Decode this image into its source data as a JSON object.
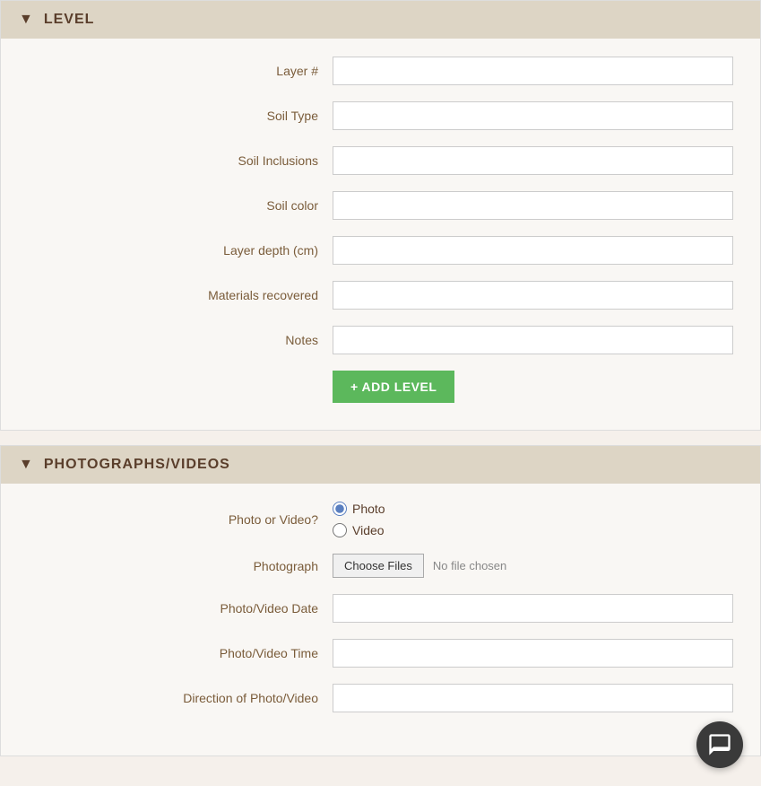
{
  "level_section": {
    "title": "LEVEL",
    "chevron": "▼",
    "fields": [
      {
        "label": "Layer #",
        "name": "layer-number",
        "value": ""
      },
      {
        "label": "Soil Type",
        "name": "soil-type",
        "value": ""
      },
      {
        "label": "Soil Inclusions",
        "name": "soil-inclusions",
        "value": ""
      },
      {
        "label": "Soil color",
        "name": "soil-color",
        "value": ""
      },
      {
        "label": "Layer depth (cm)",
        "name": "layer-depth",
        "value": ""
      },
      {
        "label": "Materials recovered",
        "name": "materials-recovered",
        "value": ""
      },
      {
        "label": "Notes",
        "name": "notes",
        "value": ""
      }
    ],
    "add_button": "+ ADD LEVEL"
  },
  "photos_section": {
    "title": "PHOTOGRAPHS/VIDEOS",
    "chevron": "▼",
    "photo_video_label": "Photo or Video?",
    "photo_option": "Photo",
    "video_option": "Video",
    "photograph_label": "Photograph",
    "choose_files_label": "Choose Files",
    "no_file_text": "No file chosen",
    "photo_date_label": "Photo/Video Date",
    "photo_time_label": "Photo/Video Time",
    "direction_label": "Direction of Photo/Video"
  },
  "chat": {
    "icon": "💬"
  }
}
